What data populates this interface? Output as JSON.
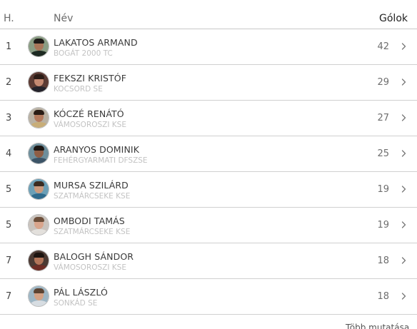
{
  "header": {
    "rank": "H.",
    "name": "Név",
    "goals": "Gólok"
  },
  "rows": [
    {
      "rank": "1",
      "name": "LAKATOS ARMAND",
      "club": "BOGÁT 2000 TC",
      "goals": "42",
      "avatar": {
        "bg": "#8a9d84",
        "skin": "#a9765a",
        "hair": "#1f1b18",
        "shirt": "#1d2a22"
      }
    },
    {
      "rank": "2",
      "name": "FEKSZI KRISTÓF",
      "club": "KOCSORD SE",
      "goals": "29",
      "avatar": {
        "bg": "#5b3b34",
        "skin": "#c48a72",
        "hair": "#2b1c16",
        "shirt": "#24232b"
      }
    },
    {
      "rank": "3",
      "name": "KÓCZÉ RENÁTÓ",
      "club": "VÁMOSOROSZI KSE",
      "goals": "27",
      "avatar": {
        "bg": "#b9b1a3",
        "skin": "#b47a5d",
        "hair": "#2a1c15",
        "shirt": "#c8ad78"
      }
    },
    {
      "rank": "4",
      "name": "ARANYOS DOMINIK",
      "club": "FEHÉRGYARMATI DFSZSE",
      "goals": "25",
      "avatar": {
        "bg": "#6e8e9b",
        "skin": "#8f5e45",
        "hair": "#1b1512",
        "shirt": "#3c5467"
      }
    },
    {
      "rank": "5",
      "name": "MURSA SZILÁRD",
      "club": "SZATMÁRCSEKE KSE",
      "goals": "19",
      "avatar": {
        "bg": "#6b9fb6",
        "skin": "#c99a7e",
        "hair": "#3a2b20",
        "shirt": "#2f6a8c"
      }
    },
    {
      "rank": "5",
      "name": "OMBODI TAMÁS",
      "club": "SZATMÁRCSEKE KSE",
      "goals": "19",
      "avatar": {
        "bg": "#c9c3bd",
        "skin": "#d9a58c",
        "hair": "#6d4f3a",
        "shirt": "#e3e0dc"
      }
    },
    {
      "rank": "7",
      "name": "BALOGH SÁNDOR",
      "club": "VÁMOSOROSZI KSE",
      "goals": "18",
      "avatar": {
        "bg": "#4b3a33",
        "skin": "#b37559",
        "hair": "#1c1410",
        "shirt": "#6e2d25"
      }
    },
    {
      "rank": "7",
      "name": "PÁL LÁSZLÓ",
      "club": "SONKÁD SE",
      "goals": "18",
      "avatar": {
        "bg": "#9eb6c4",
        "skin": "#d3a286",
        "hair": "#5c4332",
        "shirt": "#d7dde2"
      }
    }
  ],
  "footer": {
    "more_label": "Több mutatása"
  },
  "colors": {
    "divider": "#d0d0d0",
    "club_text": "#c3c3c3",
    "chevron": "#777777"
  },
  "icons": {
    "row_chevron": "chevron-right-icon",
    "player_photo": "player-avatar-icon"
  }
}
